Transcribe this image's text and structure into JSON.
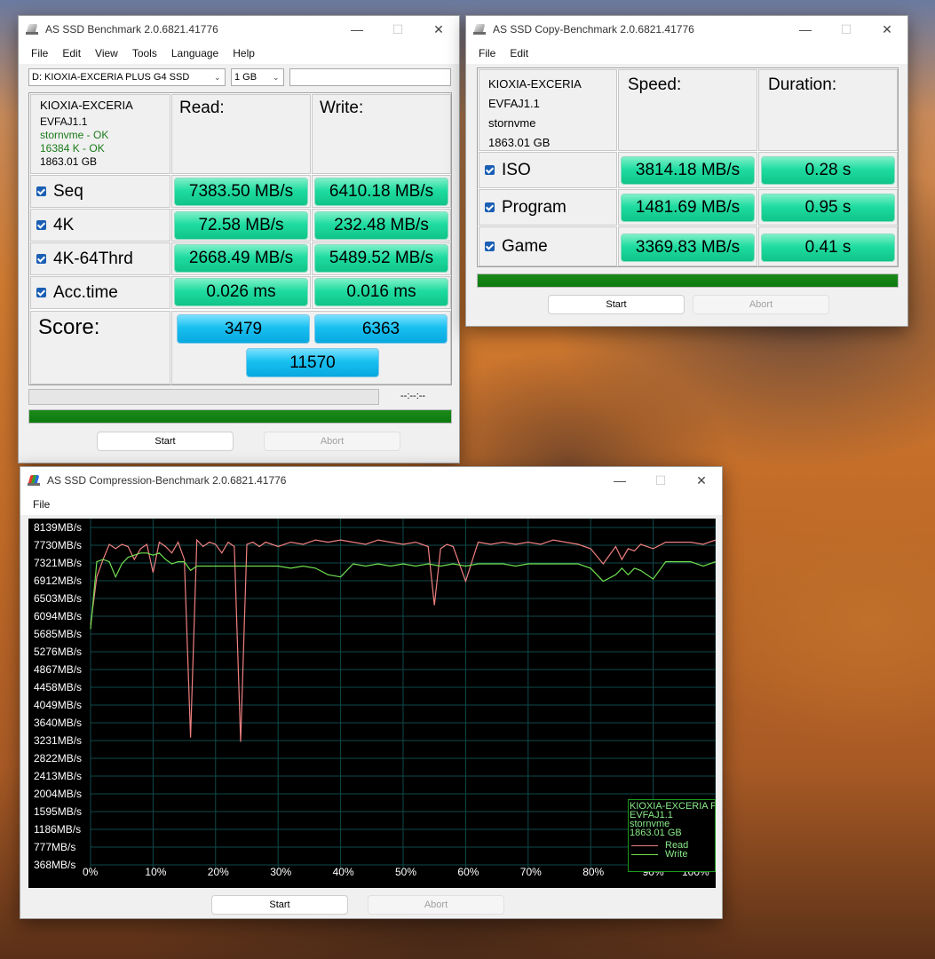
{
  "main": {
    "title": "AS SSD Benchmark 2.0.6821.41776",
    "menu": [
      "File",
      "Edit",
      "View",
      "Tools",
      "Language",
      "Help"
    ],
    "drive_select": "D: KIOXIA-EXCERIA PLUS G4 SSD",
    "size_select": "1 GB",
    "info": {
      "model": "KIOXIA-EXCERIA",
      "firmware": "EVFAJ1.1",
      "driver": "stornvme - OK",
      "alignment": "16384 K - OK",
      "capacity": "1863.01 GB"
    },
    "read_header": "Read:",
    "write_header": "Write:",
    "rows": [
      {
        "label": "Seq",
        "read": "7383.50 MB/s",
        "write": "6410.18 MB/s"
      },
      {
        "label": "4K",
        "read": "72.58 MB/s",
        "write": "232.48 MB/s"
      },
      {
        "label": "4K-64Thrd",
        "read": "2668.49 MB/s",
        "write": "5489.52 MB/s"
      },
      {
        "label": "Acc.time",
        "read": "0.026 ms",
        "write": "0.016 ms"
      }
    ],
    "score_label": "Score:",
    "score_read": "3479",
    "score_write": "6363",
    "score_total": "11570",
    "time_display": "--:--:--",
    "start_label": "Start",
    "abort_label": "Abort"
  },
  "copy": {
    "title": "AS SSD Copy-Benchmark 2.0.6821.41776",
    "menu": [
      "File",
      "Edit"
    ],
    "info": {
      "model": "KIOXIA-EXCERIA",
      "firmware": "EVFAJ1.1",
      "driver": "stornvme",
      "capacity": "1863.01 GB"
    },
    "speed_header": "Speed:",
    "duration_header": "Duration:",
    "rows": [
      {
        "label": "ISO",
        "speed": "3814.18 MB/s",
        "duration": "0.28 s"
      },
      {
        "label": "Program",
        "speed": "1481.69 MB/s",
        "duration": "0.95 s"
      },
      {
        "label": "Game",
        "speed": "3369.83 MB/s",
        "duration": "0.41 s"
      }
    ],
    "start_label": "Start",
    "abort_label": "Abort"
  },
  "compression": {
    "title": "AS SSD Compression-Benchmark 2.0.6821.41776",
    "menu": [
      "File"
    ],
    "start_label": "Start",
    "abort_label": "Abort",
    "legend": {
      "model": "KIOXIA-EXCERIA P",
      "firmware": "EVFAJ1.1",
      "driver": "stornvme",
      "capacity": "1863.01 GB",
      "read_label": "Read",
      "write_label": "Write"
    },
    "colors": {
      "read": "#f08080",
      "write": "#70e050",
      "grid": "#0f4a4a"
    }
  },
  "chart_data": {
    "type": "line",
    "yticks": [
      "8139MB/s",
      "7730MB/s",
      "7321MB/s",
      "6912MB/s",
      "6503MB/s",
      "6094MB/s",
      "5685MB/s",
      "5276MB/s",
      "4867MB/s",
      "4458MB/s",
      "4049MB/s",
      "3640MB/s",
      "3231MB/s",
      "2822MB/s",
      "2413MB/s",
      "2004MB/s",
      "1595MB/s",
      "1186MB/s",
      "777MB/s",
      "368MB/s"
    ],
    "xticks": [
      "0%",
      "10%",
      "20%",
      "30%",
      "40%",
      "50%",
      "60%",
      "70%",
      "80%",
      "90%",
      "100%"
    ],
    "ylim": [
      368,
      8139
    ],
    "xlim": [
      0,
      100
    ],
    "grid": true,
    "legend_position": "bottom-right",
    "series": [
      {
        "name": "Read",
        "x": [
          0,
          1,
          2,
          3,
          4,
          5,
          6,
          7,
          8,
          9,
          10,
          11,
          12,
          13,
          14,
          15,
          16,
          17,
          18,
          19,
          20,
          21,
          22,
          23,
          24,
          25,
          26,
          27,
          28,
          29,
          30,
          32,
          34,
          36,
          38,
          40,
          42,
          44,
          46,
          48,
          50,
          52,
          54,
          55,
          56,
          57,
          58,
          60,
          62,
          64,
          66,
          68,
          70,
          72,
          74,
          76,
          78,
          80,
          82,
          84,
          85,
          86,
          87,
          88,
          90,
          92,
          94,
          96,
          98,
          100
        ],
        "values": [
          5900,
          7000,
          7400,
          7750,
          7650,
          7750,
          7700,
          7400,
          7650,
          7750,
          7100,
          7800,
          7700,
          7550,
          7800,
          7400,
          3300,
          7850,
          7700,
          7800,
          7750,
          7550,
          7800,
          7700,
          3200,
          7750,
          7800,
          7700,
          7800,
          7750,
          7700,
          7800,
          7750,
          7850,
          7800,
          7850,
          7800,
          7750,
          7850,
          7800,
          7750,
          7800,
          7700,
          6350,
          7650,
          7750,
          7700,
          6900,
          7800,
          7750,
          7800,
          7750,
          7800,
          7750,
          7850,
          7800,
          7750,
          7650,
          7300,
          7700,
          7400,
          7650,
          7600,
          7750,
          7650,
          7800,
          7800,
          7800,
          7750,
          7850
        ]
      },
      {
        "name": "Write",
        "x": [
          0,
          1,
          2,
          3,
          4,
          5,
          6,
          7,
          8,
          9,
          10,
          11,
          12,
          13,
          14,
          15,
          16,
          17,
          18,
          19,
          20,
          22,
          24,
          26,
          28,
          30,
          32,
          34,
          36,
          38,
          40,
          42,
          44,
          46,
          48,
          50,
          52,
          54,
          56,
          58,
          60,
          62,
          64,
          66,
          68,
          70,
          72,
          74,
          76,
          78,
          80,
          82,
          84,
          85,
          86,
          87,
          88,
          90,
          92,
          94,
          96,
          98,
          100
        ],
        "values": [
          5800,
          7350,
          7400,
          7350,
          7000,
          7300,
          7450,
          7500,
          7550,
          7550,
          7500,
          7550,
          7400,
          7300,
          7350,
          7350,
          7150,
          7250,
          7250,
          7250,
          7250,
          7250,
          7250,
          7250,
          7250,
          7250,
          7200,
          7250,
          7200,
          7050,
          7000,
          7300,
          7250,
          7300,
          7250,
          7300,
          7250,
          7300,
          7250,
          7300,
          7250,
          7300,
          7300,
          7300,
          7250,
          7300,
          7300,
          7300,
          7300,
          7300,
          7200,
          6900,
          7050,
          7200,
          7050,
          7200,
          7150,
          6950,
          7350,
          7350,
          7350,
          7250,
          7350
        ]
      }
    ]
  }
}
